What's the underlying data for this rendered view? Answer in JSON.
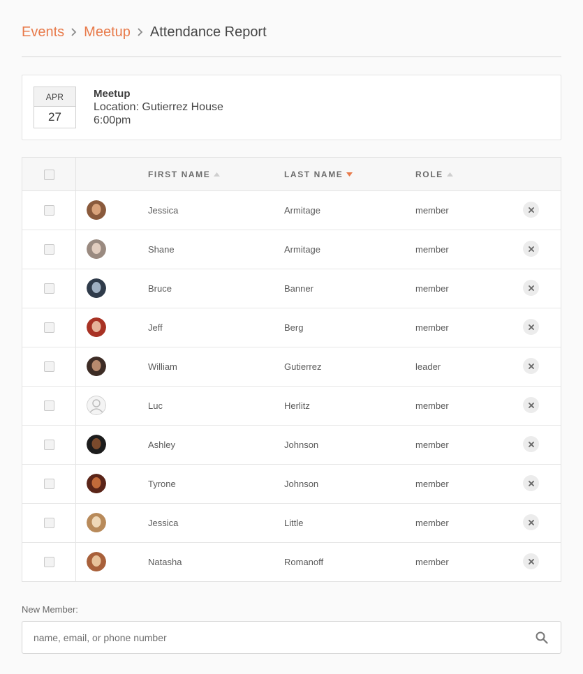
{
  "breadcrumb": {
    "items": [
      "Events",
      "Meetup"
    ],
    "current": "Attendance Report"
  },
  "event": {
    "month": "APR",
    "day": "27",
    "name": "Meetup",
    "location": "Location: Gutierrez House",
    "time": "6:00pm"
  },
  "table": {
    "columns": {
      "first_name": "FIRST NAME",
      "last_name": "LAST NAME",
      "role": "ROLE"
    },
    "sort": {
      "first_name": "asc-inactive",
      "last_name": "desc-active",
      "role": "asc-inactive"
    },
    "rows": [
      {
        "first": "Jessica",
        "last": "Armitage",
        "role": "member",
        "avatar": "avatar-photo"
      },
      {
        "first": "Shane",
        "last": "Armitage",
        "role": "member",
        "avatar": "avatar-photo"
      },
      {
        "first": "Bruce",
        "last": "Banner",
        "role": "member",
        "avatar": "avatar-photo"
      },
      {
        "first": "Jeff",
        "last": "Berg",
        "role": "member",
        "avatar": "avatar-photo"
      },
      {
        "first": "William",
        "last": "Gutierrez",
        "role": "leader",
        "avatar": "avatar-photo"
      },
      {
        "first": "Luc",
        "last": "Herlitz",
        "role": "member",
        "avatar": "avatar-placeholder"
      },
      {
        "first": "Ashley",
        "last": "Johnson",
        "role": "member",
        "avatar": "avatar-photo"
      },
      {
        "first": "Tyrone",
        "last": "Johnson",
        "role": "member",
        "avatar": "avatar-photo"
      },
      {
        "first": "Jessica",
        "last": "Little",
        "role": "member",
        "avatar": "avatar-photo"
      },
      {
        "first": "Natasha",
        "last": "Romanoff",
        "role": "member",
        "avatar": "avatar-photo"
      }
    ]
  },
  "new_member": {
    "label": "New Member:",
    "placeholder": "name, email, or phone number"
  },
  "colors": {
    "accent": "#e87a4a",
    "text": "#444444",
    "border": "#e3e3e3"
  },
  "icons": {
    "separator": "chevron-right-icon",
    "remove": "close-icon",
    "search": "search-icon",
    "sort": "sort-arrow-icon"
  }
}
